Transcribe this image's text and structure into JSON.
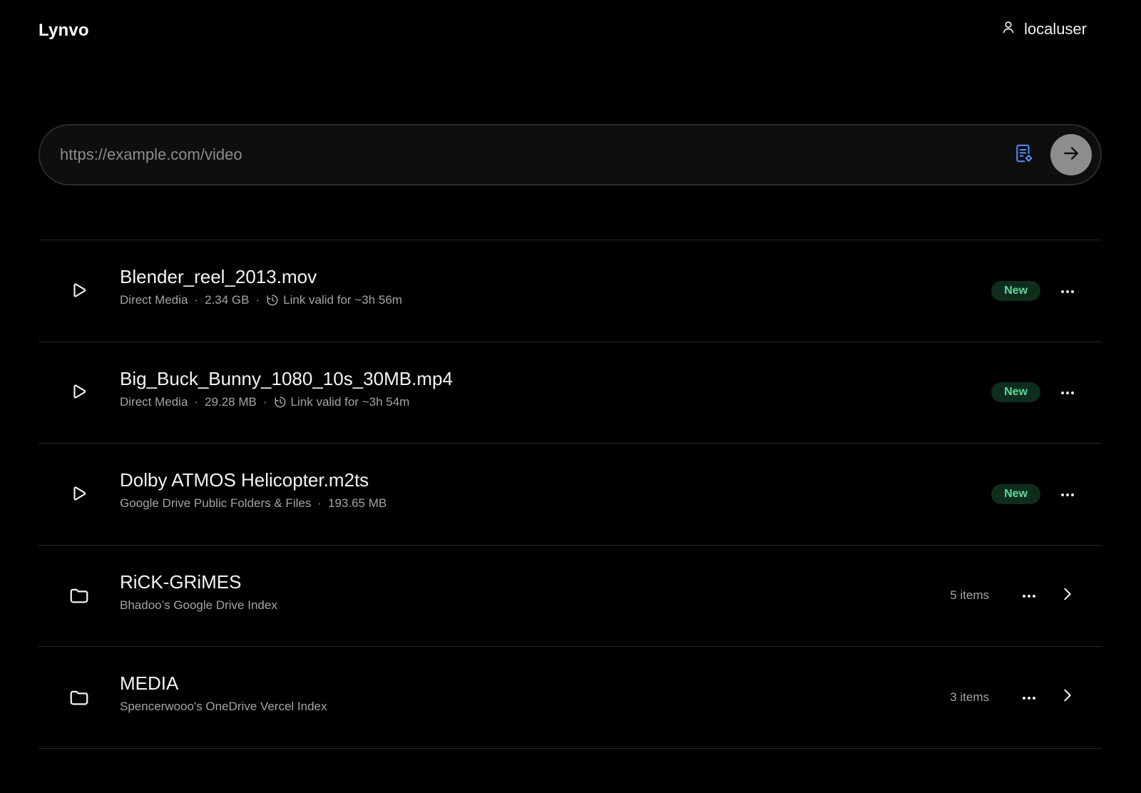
{
  "app": {
    "brand": "Lynvo",
    "user": {
      "name": "localuser",
      "icon": "user-icon"
    }
  },
  "url_input": {
    "placeholder": "https://example.com/video",
    "value": "",
    "paste_icon": "clipboard-paste-icon",
    "submit_icon": "arrow-right-icon"
  },
  "colors": {
    "background": "#000000",
    "badge_bg": "#0f2d1d",
    "badge_text": "#5fd89a",
    "submit_button": "#8d8d8d",
    "paste_icon": "#4f8ff7"
  },
  "items": [
    {
      "type": "media",
      "icon": "play-icon",
      "title": "Blender_reel_2013.mov",
      "source": "Direct Media",
      "size": "2.34 GB",
      "validity": "Link valid for ~3h 56m",
      "badge": "New"
    },
    {
      "type": "media",
      "icon": "play-icon",
      "title": "Big_Buck_Bunny_1080_10s_30MB.mp4",
      "source": "Direct Media",
      "size": "29.28 MB",
      "validity": "Link valid for ~3h 54m",
      "badge": "New"
    },
    {
      "type": "media",
      "icon": "play-icon",
      "title": "Dolby ATMOS Helicopter.m2ts",
      "source": "Google Drive Public Folders & Files",
      "size": "193.65 MB",
      "badge": "New"
    },
    {
      "type": "folder",
      "icon": "folder-icon",
      "title": "RiCK-GRiMES",
      "source": "Bhadoo’s Google Drive Index",
      "count": "5 items"
    },
    {
      "type": "folder",
      "icon": "folder-icon",
      "title": "MEDIA",
      "source": "Spencerwooo's OneDrive Vercel Index",
      "count": "3 items"
    }
  ]
}
